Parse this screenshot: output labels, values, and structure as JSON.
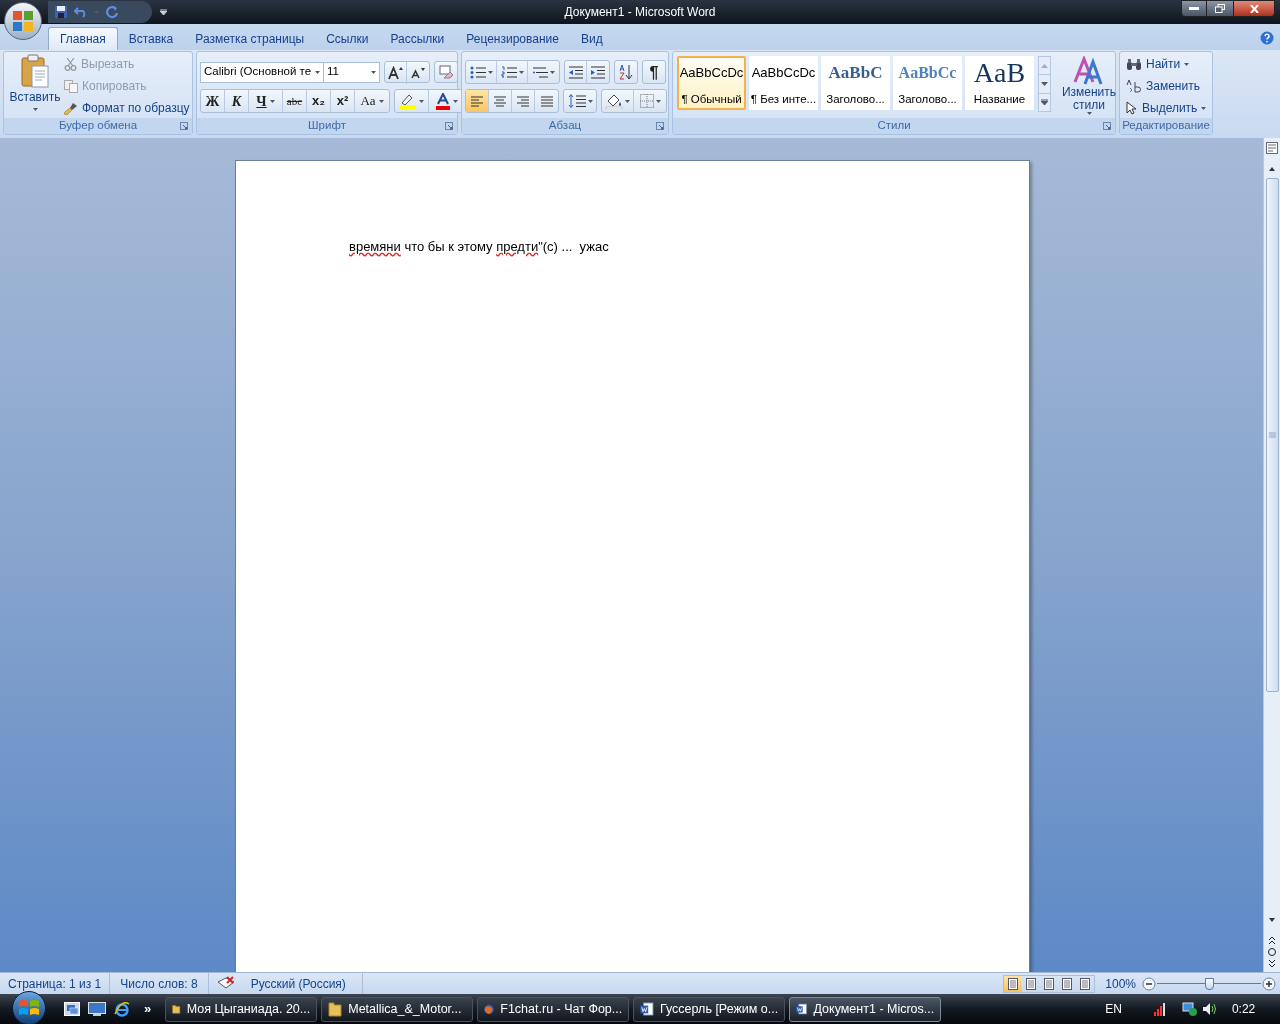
{
  "window": {
    "title": "Документ1 - Microsoft Word"
  },
  "tabs": [
    {
      "label": "Главная",
      "selected": true
    },
    {
      "label": "Вставка",
      "selected": false
    },
    {
      "label": "Разметка страницы",
      "selected": false
    },
    {
      "label": "Ссылки",
      "selected": false
    },
    {
      "label": "Рассылки",
      "selected": false
    },
    {
      "label": "Рецензирование",
      "selected": false
    },
    {
      "label": "Вид",
      "selected": false
    }
  ],
  "clipboard": {
    "label": "Буфер обмена",
    "paste": "Вставить",
    "items": [
      {
        "label": "Вырезать",
        "disabled": true,
        "kind": "cut"
      },
      {
        "label": "Копировать",
        "disabled": true,
        "kind": "copy"
      },
      {
        "label": "Формат по образцу",
        "disabled": false,
        "kind": "brush"
      }
    ]
  },
  "font": {
    "label": "Шрифт",
    "font_name": "Calibri (Основной те",
    "font_size": "11",
    "format_buttons": [
      {
        "label": "Ж",
        "kind": "bold"
      },
      {
        "label": "К",
        "kind": "italic"
      },
      {
        "label": "Ч",
        "kind": "underline"
      },
      {
        "label": "abc",
        "kind": "strike"
      },
      {
        "label": "x₂",
        "kind": "sub"
      },
      {
        "label": "x²",
        "kind": "sup"
      },
      {
        "label": "Aa",
        "kind": "case"
      }
    ]
  },
  "paragraph": {
    "label": "Абзац",
    "show_marks": "¶",
    "align_buttons": [
      {
        "selected": true
      },
      {
        "selected": false
      },
      {
        "selected": false
      },
      {
        "selected": false
      }
    ]
  },
  "styles": {
    "label": "Стили",
    "change_styles": "Изменить стили",
    "items": [
      {
        "preview": "AaBbCcDc",
        "name": "¶ Обычный",
        "kind": "normal",
        "selected": true
      },
      {
        "preview": "AaBbCcDc",
        "name": "¶ Без инте...",
        "kind": "normal",
        "selected": false
      },
      {
        "preview": "AaBbC",
        "name": "Заголово...",
        "kind": "heading1",
        "selected": false
      },
      {
        "preview": "AaBbCc",
        "name": "Заголово...",
        "kind": "heading2",
        "selected": false
      },
      {
        "preview": "AaB",
        "name": "Название",
        "kind": "title",
        "selected": false
      }
    ]
  },
  "editing": {
    "label": "Редактирование",
    "items": [
      {
        "label": "Найти",
        "kind": "find"
      },
      {
        "label": "Заменить",
        "kind": "replace"
      },
      {
        "label": "Выделить",
        "kind": "select"
      }
    ]
  },
  "document": {
    "segments": [
      {
        "text": "времяни",
        "misspelled": true
      },
      {
        "text": " что бы к этому ",
        "misspelled": false
      },
      {
        "text": "предти",
        "misspelled": true
      },
      {
        "text": "\"(с) ...  ужас",
        "misspelled": false
      }
    ]
  },
  "status_bar": {
    "page": "Страница: 1 из 1",
    "words": "Число слов: 8",
    "language": "Русский (Россия)",
    "view_buttons": [
      {
        "selected": true
      },
      {
        "selected": false
      },
      {
        "selected": false
      },
      {
        "selected": false
      },
      {
        "selected": false
      }
    ],
    "zoom": "100%",
    "zoom_slider": {
      "level": 0.5
    }
  },
  "taskbar": {
    "more": "»",
    "buttons": [
      {
        "label": "Моя Цыганиада. 20...",
        "kind": "folder",
        "active": false
      },
      {
        "label": "Metallica_&_Motor...",
        "kind": "folder",
        "active": false
      },
      {
        "label": "F1chat.ru - Чат Фор...",
        "kind": "browser",
        "active": false
      },
      {
        "label": "Гуссерль [Режим о...",
        "kind": "word",
        "active": false
      },
      {
        "label": "Документ1 - Micros...",
        "kind": "word",
        "active": true
      }
    ],
    "language": "EN",
    "clock": "0:22"
  }
}
